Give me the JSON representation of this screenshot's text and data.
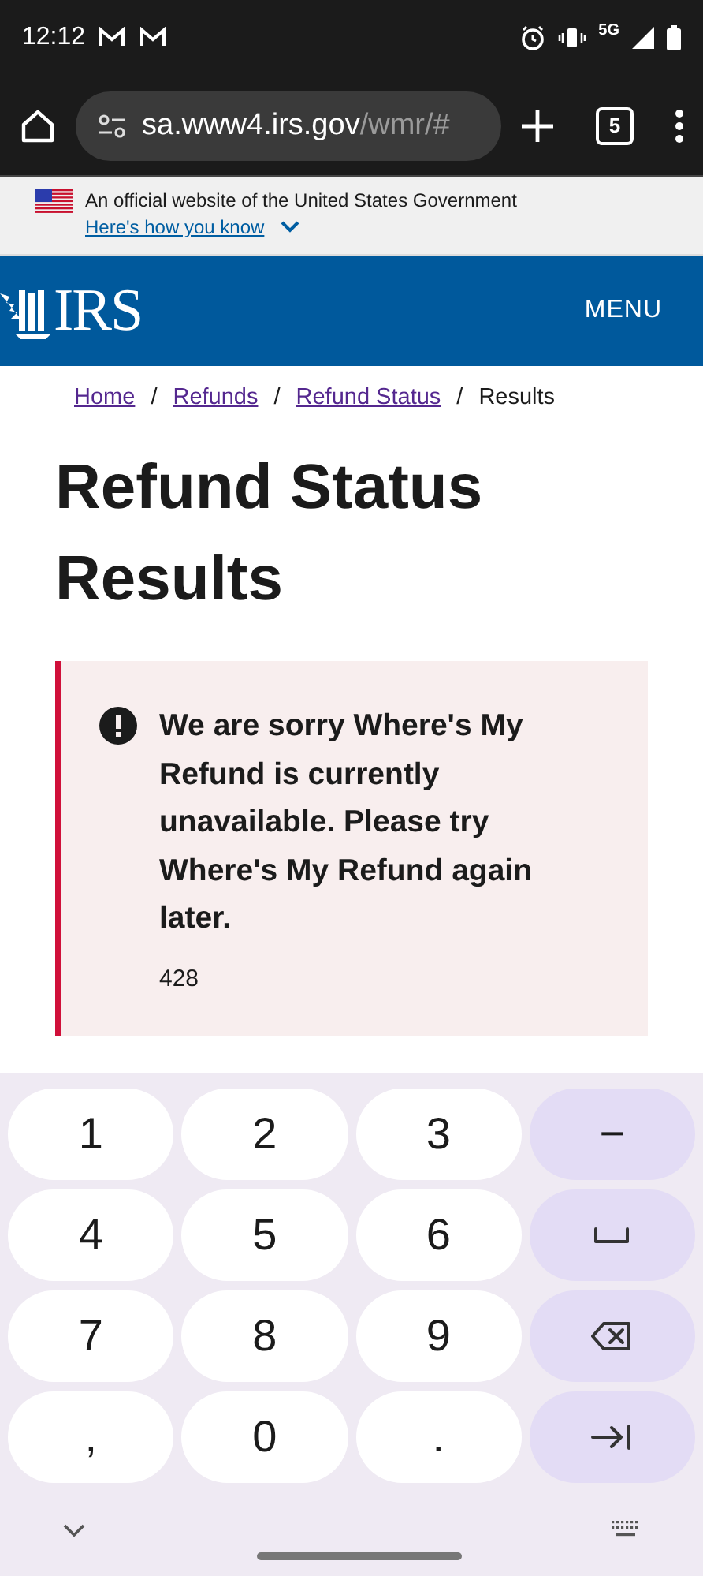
{
  "status_bar": {
    "time": "12:12",
    "network": "5G"
  },
  "browser": {
    "url_host": "sa.www4.irs.gov",
    "url_path": "/wmr/#",
    "tab_count": "5"
  },
  "gov_banner": {
    "text": "An official website of the United States Government",
    "link": "Here's how you know",
    "expanded": false
  },
  "header": {
    "logo_text": "IRS",
    "menu": "MENU"
  },
  "breadcrumb_separator": "/",
  "breadcrumb": [
    {
      "label": "Home",
      "kind": "link"
    },
    {
      "label": "Refunds",
      "kind": "link"
    },
    {
      "label": "Refund Status",
      "kind": "link"
    },
    {
      "label": "Results",
      "kind": "current"
    }
  ],
  "page_title": "Refund Status Results",
  "alert": {
    "message": "We are sorry Where's My Refund is currently unavailable. Please try Where's My Refund again later.",
    "code": "428"
  },
  "keyboard": {
    "keys": [
      {
        "kind": "char",
        "label": "1"
      },
      {
        "kind": "char",
        "label": "2"
      },
      {
        "kind": "char",
        "label": "3"
      },
      {
        "kind": "action",
        "label": "−"
      },
      {
        "kind": "char",
        "label": "4"
      },
      {
        "kind": "char",
        "label": "5"
      },
      {
        "kind": "char",
        "label": "6"
      },
      {
        "kind": "space"
      },
      {
        "kind": "char",
        "label": "7"
      },
      {
        "kind": "char",
        "label": "8"
      },
      {
        "kind": "char",
        "label": "9"
      },
      {
        "kind": "backspace"
      },
      {
        "kind": "char",
        "label": ","
      },
      {
        "kind": "char",
        "label": "0"
      },
      {
        "kind": "char",
        "label": "."
      },
      {
        "kind": "next"
      }
    ]
  }
}
